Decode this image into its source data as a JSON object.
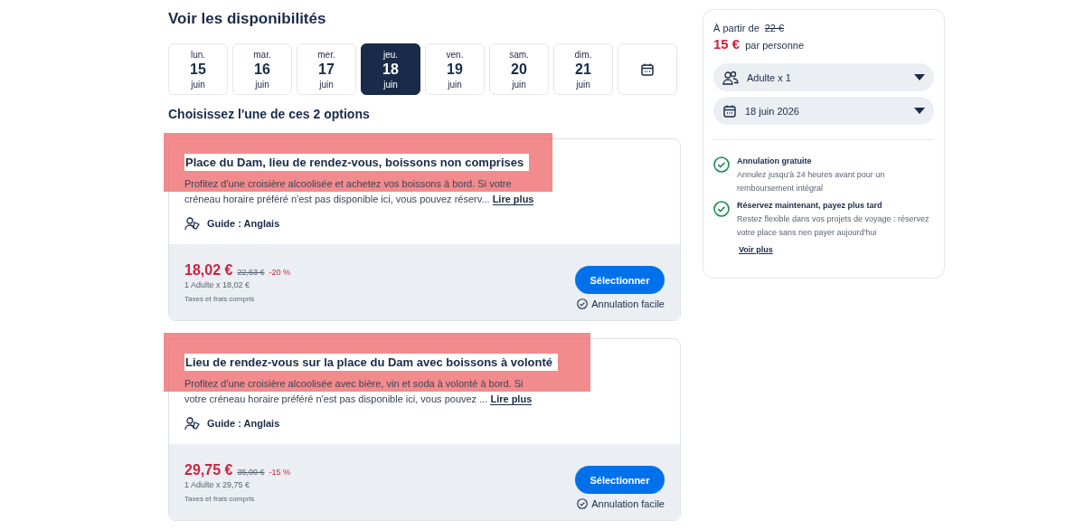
{
  "availability": {
    "title": "Voir les disponibilités",
    "days": [
      {
        "weekday": "lun.",
        "day": "15",
        "month": "juin",
        "selected": false
      },
      {
        "weekday": "mar.",
        "day": "16",
        "month": "juin",
        "selected": false
      },
      {
        "weekday": "mer.",
        "day": "17",
        "month": "juin",
        "selected": false
      },
      {
        "weekday": "jeu.",
        "day": "18",
        "month": "juin",
        "selected": true
      },
      {
        "weekday": "ven.",
        "day": "19",
        "month": "juin",
        "selected": false
      },
      {
        "weekday": "sam.",
        "day": "20",
        "month": "juin",
        "selected": false
      },
      {
        "weekday": "dim.",
        "day": "21",
        "month": "juin",
        "selected": false
      }
    ]
  },
  "options_title": "Choisissez l'une de ces 2 options",
  "options": [
    {
      "title": "Place du Dam, lieu de rendez-vous, boissons non comprises",
      "highlighted": true,
      "description": "Profitez d'une croisière alcoolisée et achetez vos boissons à bord. Si votre créneau horaire préféré n'est pas disponible ici, vous pouvez réserv...",
      "more": "Lire plus",
      "guide": "Guide : Anglais",
      "price": "18,02 €",
      "old_price": "22,63 €",
      "discount": "-20 %",
      "per_person": "1 Adulte x 18,02 €",
      "taxes": "Taxes et frais compris",
      "button": "Sélectionner",
      "cancellation": "Annulation facile"
    },
    {
      "title": "Lieu de rendez-vous sur la place du Dam avec boissons à volonté",
      "highlighted": true,
      "description": "Profitez d'une croisière alcoolisée avec bière, vin et soda à volonté à bord. Si votre créneau horaire préféré n'est pas disponible ici, vous pouvez ...",
      "more": "Lire plus",
      "guide": "Guide : Anglais",
      "price": "29,75 €",
      "old_price": "35,00 €",
      "discount": "-15 %",
      "per_person": "1 Adulte x 29,75 €",
      "taxes": "Taxes et frais compris",
      "button": "Sélectionner",
      "cancellation": "Annulation facile"
    }
  ],
  "booking": {
    "from_label": "À partir de",
    "old_price": "22 €",
    "price": "15 €",
    "per": "par personne",
    "travelers": "Adulte x 1",
    "date": "18 juin 2026",
    "benefits": [
      {
        "title": "Annulation gratuite",
        "text": "Annulez jusqu'à 24 heures avant pour un remboursement intégral"
      },
      {
        "title": "Réservez maintenant, payez plus tard",
        "text": "Restez flexible dans vos projets de voyage : réservez votre place sans rien payer aujourd'hui"
      }
    ],
    "more": "Voir plus"
  }
}
